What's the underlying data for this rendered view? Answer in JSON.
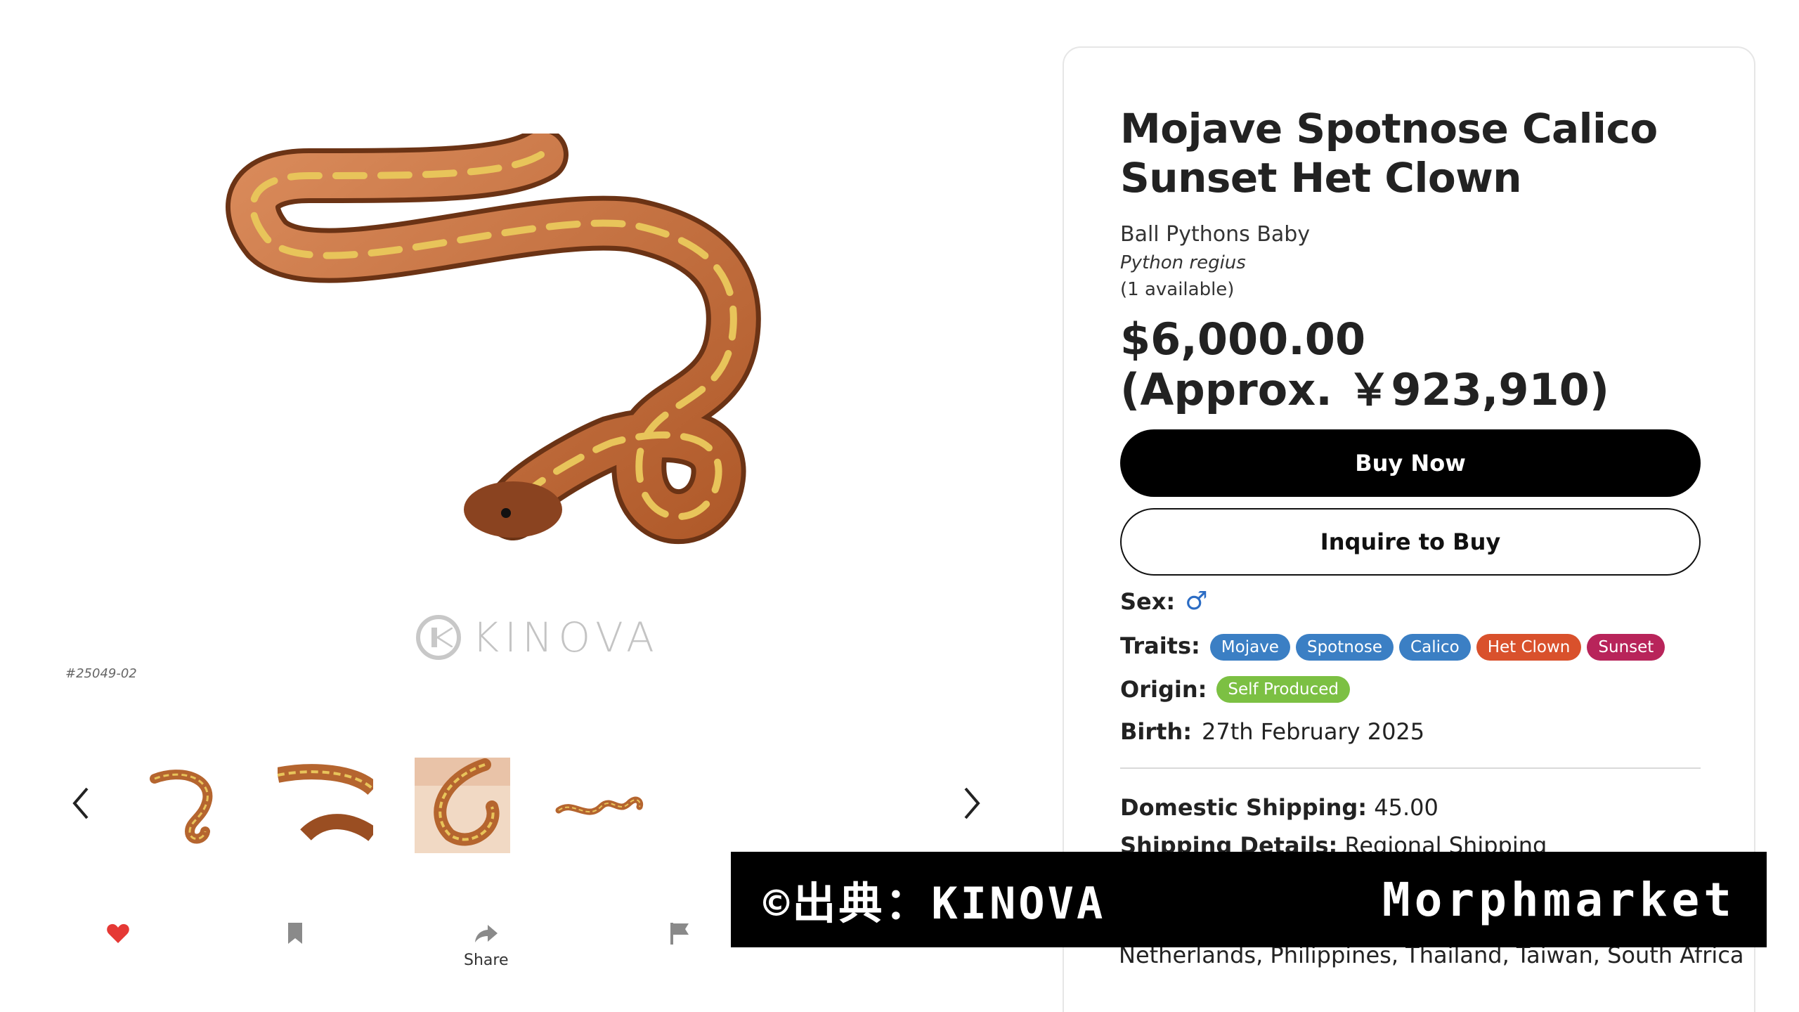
{
  "gallery": {
    "watermark_text": "KINOVA",
    "sku": "#25049-02",
    "thumb_count": 4
  },
  "actions": {
    "share_label": "Share"
  },
  "listing": {
    "title": "Mojave Spotnose Calico Sunset Het Clown",
    "category": "Ball Pythons Baby",
    "latin_name": "Python regius",
    "availability": "(1 available)",
    "price_usd": "$6,000.00",
    "price_jpy": "(Approx. ￥923,910)",
    "buy_now_label": "Buy Now",
    "inquire_label": "Inquire to Buy",
    "sex_label": "Sex:",
    "sex_icon": "male-symbol",
    "sex_symbol": "♂",
    "traits_label": "Traits:",
    "traits": [
      {
        "name": "Mojave",
        "color": "#3b7fc4"
      },
      {
        "name": "Spotnose",
        "color": "#3b7fc4"
      },
      {
        "name": "Calico",
        "color": "#3b7fc4"
      },
      {
        "name": "Het Clown",
        "color": "#d9512c"
      },
      {
        "name": "Sunset",
        "color": "#b8245a"
      }
    ],
    "origin_label": "Origin:",
    "origin_tag": {
      "name": "Self Produced",
      "color": "#7cc043"
    },
    "birth_label": "Birth:",
    "birth_value": "27th February 2025",
    "domestic_shipping_label": "Domestic Shipping:",
    "domestic_shipping_value": "45.00",
    "shipping_details_label": "Shipping Details:",
    "shipping_details_value": "Regional Shipping",
    "countries": "Netherlands, Philippines, Thailand, Taiwan, South Africa"
  },
  "banner": {
    "source_text": "©出典：KINOVA",
    "site_text": "Morphmarket"
  },
  "colors": {
    "heart": "#e53935",
    "icon_gray": "#8a8a8a",
    "sex_blue": "#2b6cc4"
  }
}
